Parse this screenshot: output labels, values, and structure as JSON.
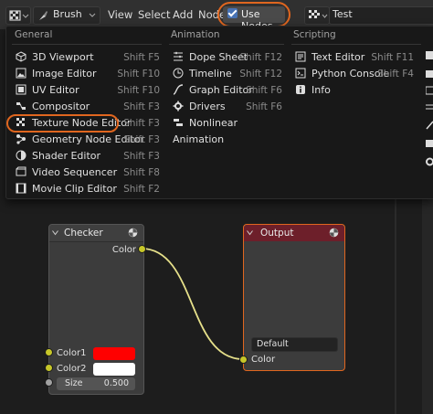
{
  "header": {
    "mode_label": "Brush",
    "menu": [
      "View",
      "Select",
      "Add",
      "Node"
    ],
    "use_nodes_label": "Use Nodes",
    "use_nodes_checked": true,
    "texture_name": "Test"
  },
  "editor_menu": {
    "columns": [
      {
        "title": "General",
        "items": [
          {
            "label": "3D Viewport",
            "shortcut": "Shift F5",
            "icon": "viewport-3d-icon"
          },
          {
            "label": "Image Editor",
            "shortcut": "Shift F10",
            "icon": "image-editor-icon"
          },
          {
            "label": "UV Editor",
            "shortcut": "Shift F10",
            "icon": "uv-editor-icon"
          },
          {
            "label": "Compositor",
            "shortcut": "Shift F3",
            "icon": "compositor-icon"
          },
          {
            "label": "Texture Node Editor",
            "shortcut": "Shift F3",
            "icon": "texture-node-icon"
          },
          {
            "label": "Geometry Node Editor",
            "shortcut": "Shift F3",
            "icon": "geometry-node-icon"
          },
          {
            "label": "Shader Editor",
            "shortcut": "Shift F3",
            "icon": "shader-editor-icon"
          },
          {
            "label": "Video Sequencer",
            "shortcut": "Shift F8",
            "icon": "video-sequencer-icon"
          },
          {
            "label": "Movie Clip Editor",
            "shortcut": "Shift F2",
            "icon": "movie-clip-icon"
          }
        ]
      },
      {
        "title": "Animation",
        "items": [
          {
            "label": "Dope Sheet",
            "shortcut": "Shift F12",
            "icon": "dope-sheet-icon"
          },
          {
            "label": "Timeline",
            "shortcut": "Shift F12",
            "icon": "timeline-icon"
          },
          {
            "label": "Graph Editor",
            "shortcut": "Shift F6",
            "icon": "graph-editor-icon"
          },
          {
            "label": "Drivers",
            "shortcut": "Shift F6",
            "icon": "drivers-icon"
          },
          {
            "label": "Nonlinear Animation",
            "shortcut": "",
            "icon": "nla-icon"
          }
        ]
      },
      {
        "title": "Scripting",
        "items": [
          {
            "label": "Text Editor",
            "shortcut": "Shift F11",
            "icon": "text-editor-icon"
          },
          {
            "label": "Python Console",
            "shortcut": "Shift F4",
            "icon": "python-console-icon"
          },
          {
            "label": "Info",
            "shortcut": "",
            "icon": "info-icon"
          }
        ]
      }
    ]
  },
  "nodes": {
    "checker": {
      "title": "Checker",
      "output_label": "Color",
      "color1_label": "Color1",
      "color1_value": "#ff0000",
      "color2_label": "Color2",
      "color2_value": "#ffffff",
      "size_label": "Size",
      "size_value": "0.500"
    },
    "output": {
      "title": "Output",
      "name_value": "Default",
      "input_label": "Color"
    }
  },
  "colors": {
    "accent": "#4772b3",
    "highlight_ring": "#e0661f",
    "socket": "#c7c729",
    "output_header": "#6d1f2a"
  }
}
